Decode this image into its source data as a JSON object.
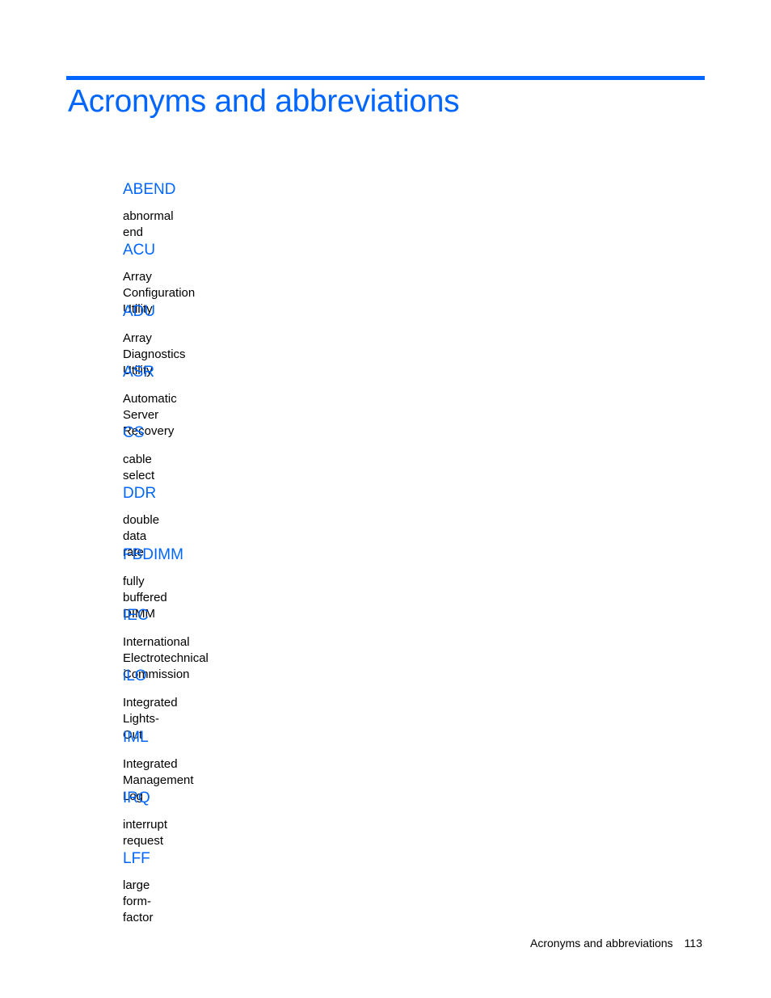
{
  "header": {
    "title": "Acronyms and abbreviations",
    "accent_color": "#0066ff"
  },
  "entries": [
    {
      "term": "ABEND",
      "definition": "abnormal end"
    },
    {
      "term": "ACU",
      "definition": "Array Configuration Utility"
    },
    {
      "term": "ADU",
      "definition": "Array Diagnostics Utility"
    },
    {
      "term": "ASR",
      "definition": "Automatic Server Recovery"
    },
    {
      "term": "CS",
      "definition": "cable select"
    },
    {
      "term": "DDR",
      "definition": "double data rate"
    },
    {
      "term": "FBDIMM",
      "definition": "fully buffered DIMM"
    },
    {
      "term": "IEC",
      "definition": "International Electrotechnical Commission"
    },
    {
      "term": "iLO",
      "definition": "Integrated Lights-Out"
    },
    {
      "term": "IML",
      "definition": "Integrated Management Log"
    },
    {
      "term": "IRQ",
      "definition": "interrupt request"
    },
    {
      "term": "LFF",
      "definition": "large form-factor"
    }
  ],
  "footer": {
    "section": "Acronyms and abbreviations",
    "page_number": "113"
  }
}
